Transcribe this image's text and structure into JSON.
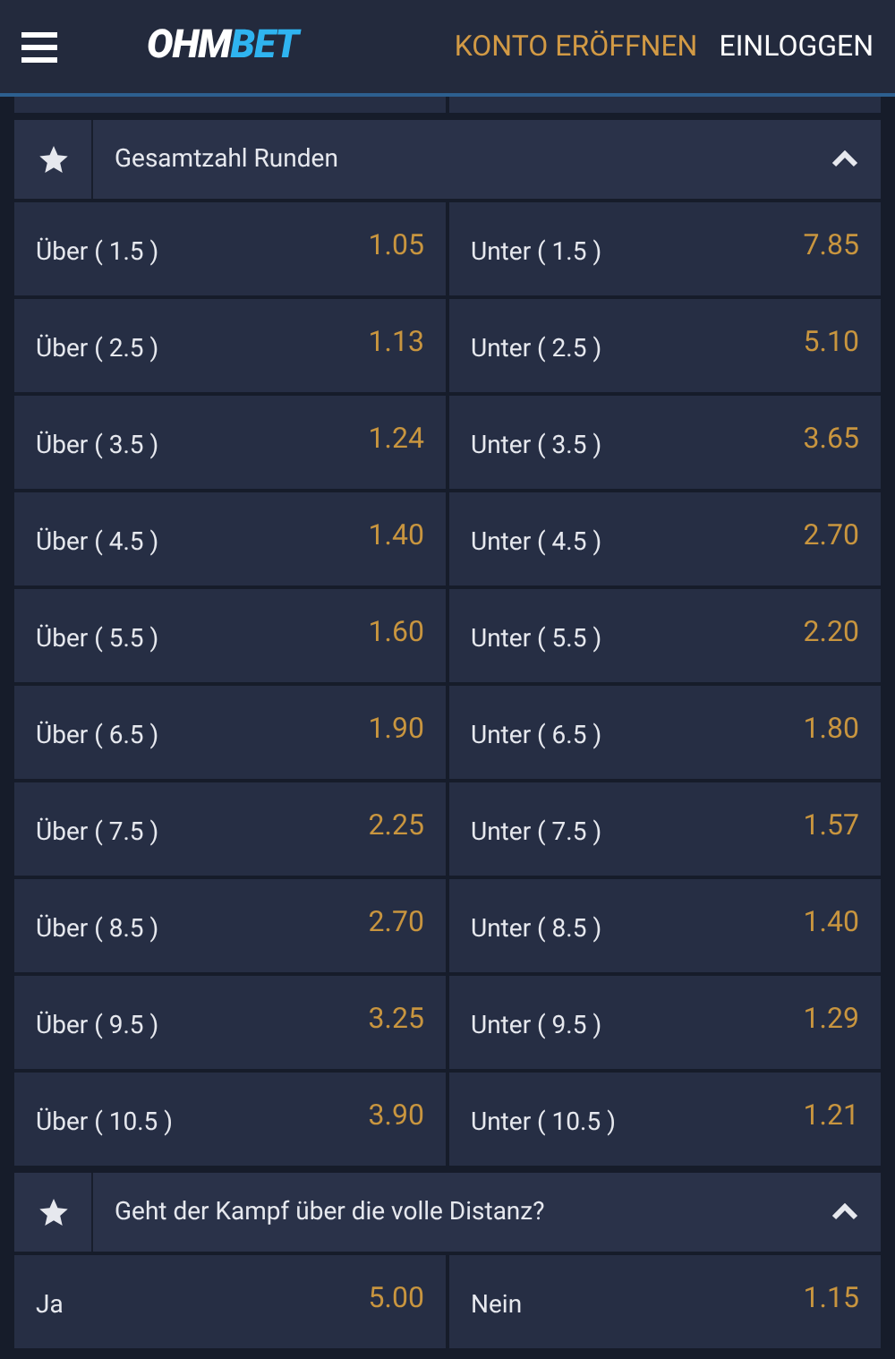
{
  "header": {
    "logo_left": "OHM",
    "logo_right": "BET",
    "register": "KONTO ERÖFFNEN",
    "login": "EINLOGGEN"
  },
  "markets": [
    {
      "title": "Gesamtzahl Runden",
      "expanded": true,
      "rows": [
        [
          {
            "label": "Über ( 1.5 )",
            "odds": "1.05"
          },
          {
            "label": "Unter ( 1.5 )",
            "odds": "7.85"
          }
        ],
        [
          {
            "label": "Über ( 2.5 )",
            "odds": "1.13"
          },
          {
            "label": "Unter ( 2.5 )",
            "odds": "5.10"
          }
        ],
        [
          {
            "label": "Über ( 3.5 )",
            "odds": "1.24"
          },
          {
            "label": "Unter ( 3.5 )",
            "odds": "3.65"
          }
        ],
        [
          {
            "label": "Über ( 4.5 )",
            "odds": "1.40"
          },
          {
            "label": "Unter ( 4.5 )",
            "odds": "2.70"
          }
        ],
        [
          {
            "label": "Über ( 5.5 )",
            "odds": "1.60"
          },
          {
            "label": "Unter ( 5.5 )",
            "odds": "2.20"
          }
        ],
        [
          {
            "label": "Über ( 6.5 )",
            "odds": "1.90"
          },
          {
            "label": "Unter ( 6.5 )",
            "odds": "1.80"
          }
        ],
        [
          {
            "label": "Über ( 7.5 )",
            "odds": "2.25"
          },
          {
            "label": "Unter ( 7.5 )",
            "odds": "1.57"
          }
        ],
        [
          {
            "label": "Über ( 8.5 )",
            "odds": "2.70"
          },
          {
            "label": "Unter ( 8.5 )",
            "odds": "1.40"
          }
        ],
        [
          {
            "label": "Über ( 9.5 )",
            "odds": "3.25"
          },
          {
            "label": "Unter ( 9.5 )",
            "odds": "1.29"
          }
        ],
        [
          {
            "label": "Über ( 10.5 )",
            "odds": "3.90"
          },
          {
            "label": "Unter ( 10.5 )",
            "odds": "1.21"
          }
        ]
      ]
    },
    {
      "title": "Geht der Kampf über die volle Distanz?",
      "expanded": true,
      "rows": [
        [
          {
            "label": "Ja",
            "odds": "5.00"
          },
          {
            "label": "Nein",
            "odds": "1.15"
          }
        ]
      ]
    }
  ]
}
